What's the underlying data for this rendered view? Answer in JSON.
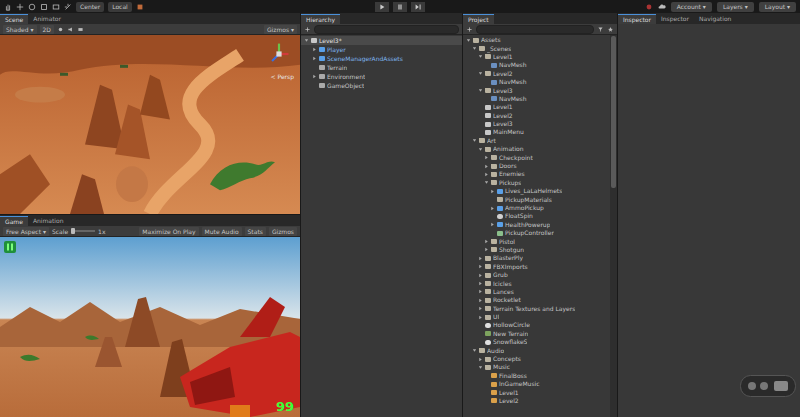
{
  "toolbar": {
    "pivot": "Center",
    "space": "Local",
    "account": "Account",
    "layers": "Layers",
    "layout": "Layout",
    "playing": false
  },
  "scene_panel": {
    "tabs": [
      {
        "label": "Scene",
        "selected": true
      },
      {
        "label": "Animator",
        "selected": false
      }
    ],
    "shading": "Shaded",
    "mode_2d": "2D",
    "gizmos": "Gizmos",
    "persp_label": "< Persp"
  },
  "game_panel": {
    "tabs": [
      {
        "label": "Game",
        "selected": true
      },
      {
        "label": "Animation",
        "selected": false
      }
    ],
    "aspect": "Free Aspect",
    "scale_label": "Scale",
    "scale_value": "1x",
    "options": [
      {
        "label": "Maximize On Play",
        "on": false
      },
      {
        "label": "Mute Audio",
        "on": false
      },
      {
        "label": "Stats",
        "on": false
      },
      {
        "label": "Gizmos",
        "on": false
      }
    ],
    "hud": {
      "ammo": "99"
    }
  },
  "hierarchy": {
    "title": "Hierarchy",
    "items": [
      {
        "label": "Level3*",
        "kind": "scene",
        "collapsible": true,
        "expanded": true,
        "selected": true,
        "children": [
          {
            "label": "Player",
            "kind": "prefab",
            "collapsible": true,
            "expanded": false,
            "selected": false
          },
          {
            "label": "SceneManagerAndAssets",
            "kind": "prefab",
            "collapsible": true,
            "expanded": false,
            "selected": false
          },
          {
            "label": "Terrain",
            "kind": "object",
            "collapsible": false,
            "expanded": false,
            "selected": false
          },
          {
            "label": "Environment",
            "kind": "object",
            "collapsible": true,
            "expanded": false,
            "selected": false
          },
          {
            "label": "GameObject",
            "kind": "object",
            "collapsible": false,
            "expanded": false,
            "selected": false
          }
        ]
      }
    ]
  },
  "project": {
    "title": "Project",
    "tree": [
      {
        "label": "Assets",
        "kind": "folder",
        "collapsible": true,
        "expanded": true,
        "children": [
          {
            "label": "_Scenes",
            "kind": "folder",
            "collapsible": true,
            "expanded": true,
            "children": [
              {
                "label": "Level1",
                "kind": "folder",
                "collapsible": true,
                "expanded": true,
                "children": [
                  {
                    "label": "NavMesh",
                    "kind": "navmesh",
                    "collapsible": false,
                    "expanded": false
                  }
                ]
              },
              {
                "label": "Level2",
                "kind": "folder",
                "collapsible": true,
                "expanded": true,
                "children": [
                  {
                    "label": "NavMesh",
                    "kind": "navmesh",
                    "collapsible": false,
                    "expanded": false
                  }
                ]
              },
              {
                "label": "Level3",
                "kind": "folder",
                "collapsible": true,
                "expanded": true,
                "children": [
                  {
                    "label": "NavMesh",
                    "kind": "navmesh",
                    "collapsible": false,
                    "expanded": false
                  }
                ]
              },
              {
                "label": "Level1",
                "kind": "scene",
                "collapsible": false,
                "expanded": false
              },
              {
                "label": "Level2",
                "kind": "scene",
                "collapsible": false,
                "expanded": false
              },
              {
                "label": "Level3",
                "kind": "scene",
                "collapsible": false,
                "expanded": false
              },
              {
                "label": "MainMenu",
                "kind": "scene",
                "collapsible": false,
                "expanded": false
              }
            ]
          },
          {
            "label": "Art",
            "kind": "folder",
            "collapsible": true,
            "expanded": true,
            "children": [
              {
                "label": "Animation",
                "kind": "folder",
                "collapsible": true,
                "expanded": true,
                "children": [
                  {
                    "label": "Checkpoint",
                    "kind": "folder",
                    "collapsible": true,
                    "expanded": false
                  },
                  {
                    "label": "Doors",
                    "kind": "folder",
                    "collapsible": true,
                    "expanded": false
                  },
                  {
                    "label": "Enemies",
                    "kind": "folder",
                    "collapsible": true,
                    "expanded": false
                  },
                  {
                    "label": "Pickups",
                    "kind": "folder",
                    "collapsible": true,
                    "expanded": true,
                    "children": [
                      {
                        "label": "Lives_LaLaHelmets",
                        "kind": "prefab",
                        "collapsible": true,
                        "expanded": false
                      },
                      {
                        "label": "PickupMaterials",
                        "kind": "folder",
                        "collapsible": false,
                        "expanded": false
                      },
                      {
                        "label": "AmmoPickup",
                        "kind": "prefab",
                        "collapsible": true,
                        "expanded": false
                      },
                      {
                        "label": "FloatSpin",
                        "kind": "anim",
                        "collapsible": false,
                        "expanded": false
                      },
                      {
                        "label": "HealthPowerup",
                        "kind": "prefab",
                        "collapsible": true,
                        "expanded": false
                      },
                      {
                        "label": "PickupController",
                        "kind": "controller",
                        "collapsible": false,
                        "expanded": false
                      }
                    ]
                  },
                  {
                    "label": "Pistol",
                    "kind": "folder",
                    "collapsible": true,
                    "expanded": false
                  },
                  {
                    "label": "Shotgun",
                    "kind": "folder",
                    "collapsible": true,
                    "expanded": false
                  }
                ]
              },
              {
                "label": "BlasterPly",
                "kind": "folder",
                "collapsible": true,
                "expanded": false
              },
              {
                "label": "FBXImports",
                "kind": "folder",
                "collapsible": true,
                "expanded": false
              },
              {
                "label": "Grub",
                "kind": "folder",
                "collapsible": true,
                "expanded": false
              },
              {
                "label": "Icicles",
                "kind": "folder",
                "collapsible": true,
                "expanded": false
              },
              {
                "label": "Lances",
                "kind": "folder",
                "collapsible": true,
                "expanded": false
              },
              {
                "label": "Rocketlet",
                "kind": "folder",
                "collapsible": true,
                "expanded": false
              },
              {
                "label": "Terrain Textures and Layers",
                "kind": "folder",
                "collapsible": true,
                "expanded": false
              },
              {
                "label": "UI",
                "kind": "folder",
                "collapsible": true,
                "expanded": false
              },
              {
                "label": "HollowCircle",
                "kind": "sprite",
                "collapsible": false,
                "expanded": false
              },
              {
                "label": "New Terrain",
                "kind": "terrain",
                "collapsible": false,
                "expanded": false
              },
              {
                "label": "SnowflakeS",
                "kind": "sprite",
                "collapsible": false,
                "expanded": false
              }
            ]
          },
          {
            "label": "Audio",
            "kind": "folder",
            "collapsible": true,
            "expanded": true,
            "children": [
              {
                "label": "Concepts",
                "kind": "folder",
                "collapsible": true,
                "expanded": false
              },
              {
                "label": "Music",
                "kind": "folder",
                "collapsible": true,
                "expanded": true,
                "children": [
                  {
                    "label": "FinalBoss",
                    "kind": "audio",
                    "collapsible": false,
                    "expanded": false
                  },
                  {
                    "label": "InGameMusic",
                    "kind": "audio",
                    "collapsible": false,
                    "expanded": false
                  },
                  {
                    "label": "Level1",
                    "kind": "audio",
                    "collapsible": false,
                    "expanded": false
                  },
                  {
                    "label": "Level2",
                    "kind": "audio",
                    "collapsible": false,
                    "expanded": false
                  }
                ]
              }
            ]
          }
        ]
      }
    ]
  },
  "inspector": {
    "tabs": [
      {
        "label": "Inspector",
        "selected": true
      },
      {
        "label": "Inspector",
        "selected": false
      },
      {
        "label": "Navigation",
        "selected": false
      }
    ]
  }
}
